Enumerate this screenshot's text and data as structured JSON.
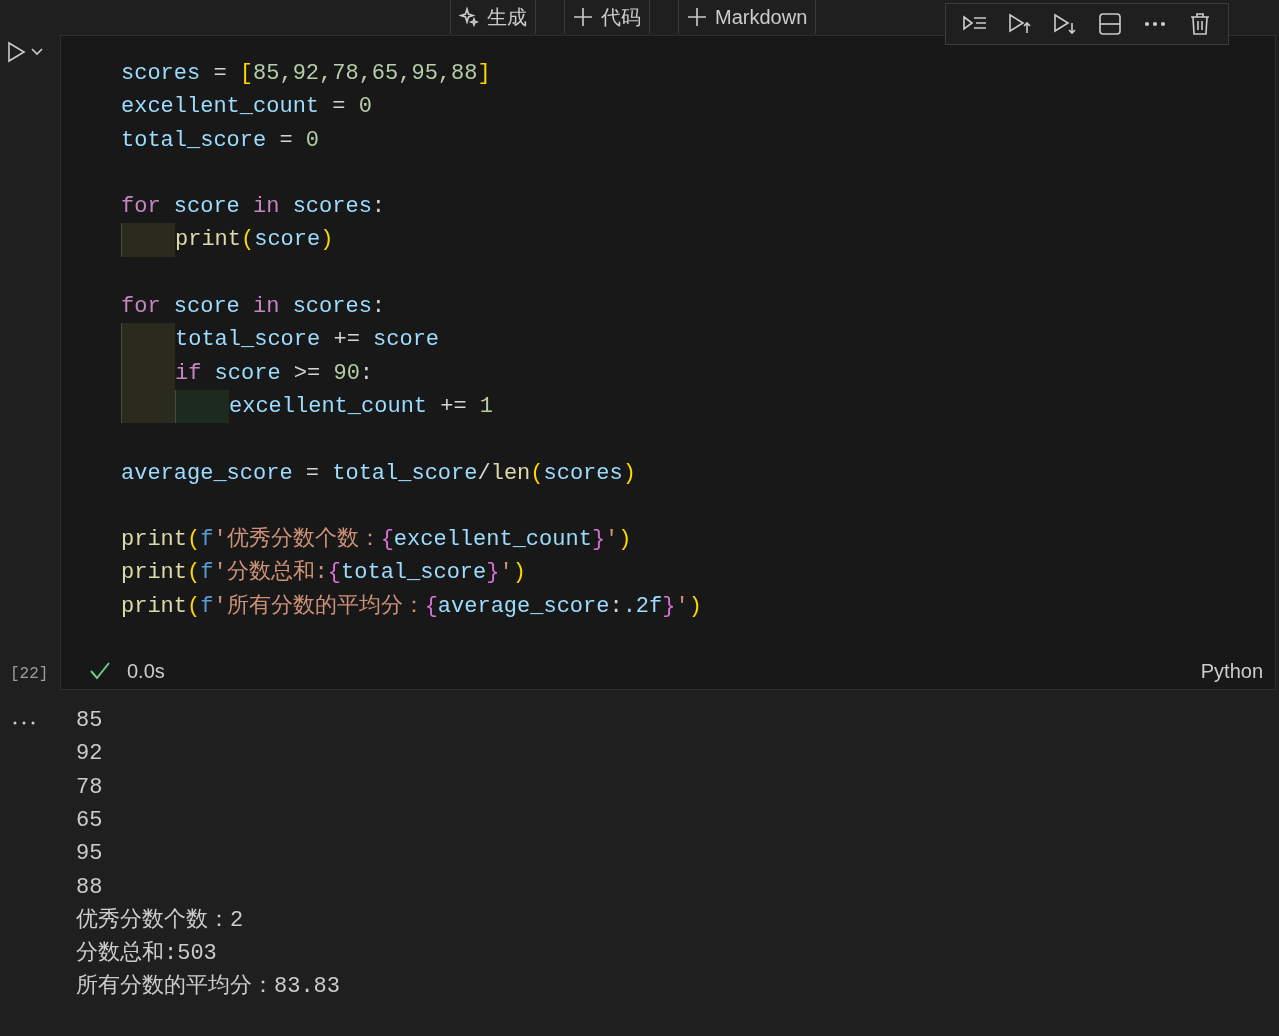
{
  "cell_toolbar": [
    {
      "label": "生成",
      "kind": "sparkle"
    },
    {
      "label": "代码",
      "kind": "plus"
    },
    {
      "label": "Markdown",
      "kind": "plus"
    }
  ],
  "code": [
    {
      "kind": "code",
      "tokens": [
        {
          "kind": "var",
          "text": "scores"
        },
        {
          "kind": "op",
          "text": " = "
        },
        {
          "kind": "bracket",
          "text": "["
        },
        {
          "kind": "num",
          "text": "85,92,78,65,95,88"
        },
        {
          "kind": "bracket",
          "text": "]"
        }
      ]
    },
    {
      "kind": "code",
      "tokens": [
        {
          "kind": "var",
          "text": "excellent_count"
        },
        {
          "kind": "op",
          "text": " = "
        },
        {
          "kind": "num",
          "text": "0"
        }
      ]
    },
    {
      "kind": "code",
      "tokens": [
        {
          "kind": "var",
          "text": "total_score"
        },
        {
          "kind": "op",
          "text": " = "
        },
        {
          "kind": "num",
          "text": "0"
        }
      ]
    },
    {
      "kind": "blank"
    },
    {
      "kind": "code",
      "tokens": [
        {
          "kind": "keyword",
          "text": "for"
        },
        {
          "kind": "var",
          "text": " score "
        },
        {
          "kind": "keyword",
          "text": "in"
        },
        {
          "kind": "var",
          "text": " scores"
        },
        {
          "kind": "op",
          "text": ":"
        }
      ],
      "children": [
        {
          "kind": "code",
          "tokens": [
            {
              "kind": "func",
              "text": "print"
            },
            {
              "kind": "bracket",
              "text": "("
            },
            {
              "kind": "var",
              "text": "score"
            },
            {
              "kind": "bracket",
              "text": ")"
            }
          ]
        }
      ]
    },
    {
      "kind": "blank"
    },
    {
      "kind": "code",
      "tokens": [
        {
          "kind": "keyword",
          "text": "for"
        },
        {
          "kind": "var",
          "text": " score "
        },
        {
          "kind": "keyword",
          "text": "in"
        },
        {
          "kind": "var",
          "text": " scores"
        },
        {
          "kind": "op",
          "text": ":"
        }
      ],
      "children": [
        {
          "kind": "code",
          "tokens": [
            {
              "kind": "var",
              "text": "total_score"
            },
            {
              "kind": "op",
              "text": " += "
            },
            {
              "kind": "var",
              "text": "score"
            }
          ]
        },
        {
          "kind": "code",
          "tokens": [
            {
              "kind": "keyword",
              "text": "if"
            },
            {
              "kind": "var",
              "text": " score "
            },
            {
              "kind": "op",
              "text": ">= "
            },
            {
              "kind": "num",
              "text": "90"
            },
            {
              "kind": "op",
              "text": ":"
            }
          ],
          "children": [
            {
              "kind": "code",
              "tokens": [
                {
                  "kind": "var",
                  "text": "excellent_count"
                },
                {
                  "kind": "op",
                  "text": " += "
                },
                {
                  "kind": "num",
                  "text": "1"
                }
              ]
            }
          ]
        }
      ]
    },
    {
      "kind": "blank"
    },
    {
      "kind": "code",
      "tokens": [
        {
          "kind": "var",
          "text": "average_score"
        },
        {
          "kind": "op",
          "text": " = "
        },
        {
          "kind": "var",
          "text": "total_score"
        },
        {
          "kind": "op",
          "text": "/"
        },
        {
          "kind": "func",
          "text": "len"
        },
        {
          "kind": "bracket",
          "text": "("
        },
        {
          "kind": "var",
          "text": "scores"
        },
        {
          "kind": "bracket",
          "text": ")"
        }
      ]
    },
    {
      "kind": "blank"
    },
    {
      "kind": "code",
      "tokens": [
        {
          "kind": "func",
          "text": "print"
        },
        {
          "kind": "bracket",
          "text": "("
        },
        {
          "kind": "prefix",
          "text": "f"
        },
        {
          "kind": "string",
          "text": "'优秀分数个数："
        },
        {
          "kind": "brace",
          "text": "{"
        },
        {
          "kind": "var",
          "text": "excellent_count"
        },
        {
          "kind": "brace",
          "text": "}"
        },
        {
          "kind": "string",
          "text": "'"
        },
        {
          "kind": "bracket",
          "text": ")"
        }
      ]
    },
    {
      "kind": "code",
      "tokens": [
        {
          "kind": "func",
          "text": "print"
        },
        {
          "kind": "bracket",
          "text": "("
        },
        {
          "kind": "prefix",
          "text": "f"
        },
        {
          "kind": "string",
          "text": "'分数总和:"
        },
        {
          "kind": "brace",
          "text": "{"
        },
        {
          "kind": "var",
          "text": "total_score"
        },
        {
          "kind": "brace",
          "text": "}"
        },
        {
          "kind": "string",
          "text": "'"
        },
        {
          "kind": "bracket",
          "text": ")"
        }
      ]
    },
    {
      "kind": "code",
      "tokens": [
        {
          "kind": "func",
          "text": "print"
        },
        {
          "kind": "bracket",
          "text": "("
        },
        {
          "kind": "prefix",
          "text": "f"
        },
        {
          "kind": "string",
          "text": "'所有分数的平均分："
        },
        {
          "kind": "brace",
          "text": "{"
        },
        {
          "kind": "var",
          "text": "average_score"
        },
        {
          "kind": "op",
          "text": ":"
        },
        {
          "kind": "var",
          "text": ".2f"
        },
        {
          "kind": "brace",
          "text": "}"
        },
        {
          "kind": "string",
          "text": "'"
        },
        {
          "kind": "bracket",
          "text": ")"
        }
      ]
    }
  ],
  "execution": {
    "count": "[22]",
    "succeeded": true,
    "time": "0.0s",
    "language": "Python"
  },
  "output": {
    "lines": [
      "85",
      "92",
      "78",
      "65",
      "95",
      "88",
      "优秀分数个数：2",
      "分数总和:503",
      "所有分数的平均分：83.83"
    ]
  }
}
